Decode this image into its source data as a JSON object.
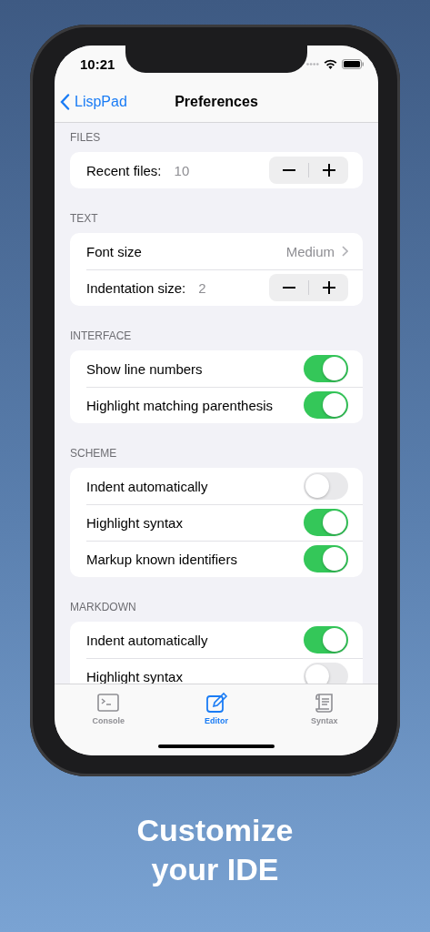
{
  "status_bar": {
    "time": "10:21"
  },
  "nav": {
    "back": "LispPad",
    "title": "Preferences"
  },
  "sections": [
    {
      "title": "FILES",
      "rows": [
        {
          "kind": "stepper",
          "label": "Recent files:",
          "value": "10"
        }
      ]
    },
    {
      "title": "TEXT",
      "rows": [
        {
          "kind": "disclosure",
          "label": "Font size",
          "value": "Medium"
        },
        {
          "kind": "stepper",
          "label": "Indentation size:",
          "value": "2"
        }
      ]
    },
    {
      "title": "INTERFACE",
      "rows": [
        {
          "kind": "toggle",
          "label": "Show line numbers",
          "on": true
        },
        {
          "kind": "toggle",
          "label": "Highlight matching parenthesis",
          "on": true
        }
      ]
    },
    {
      "title": "SCHEME",
      "rows": [
        {
          "kind": "toggle",
          "label": "Indent automatically",
          "on": false
        },
        {
          "kind": "toggle",
          "label": "Highlight syntax",
          "on": true
        },
        {
          "kind": "toggle",
          "label": "Markup known identifiers",
          "on": true
        }
      ]
    },
    {
      "title": "MARKDOWN",
      "rows": [
        {
          "kind": "toggle",
          "label": "Indent automatically",
          "on": true
        },
        {
          "kind": "toggle",
          "label": "Highlight syntax",
          "on": false
        }
      ]
    }
  ],
  "tabs": [
    {
      "label": "Console",
      "selected": false
    },
    {
      "label": "Editor",
      "selected": true
    },
    {
      "label": "Syntax",
      "selected": false
    }
  ],
  "caption": [
    "Customize",
    "your IDE"
  ]
}
